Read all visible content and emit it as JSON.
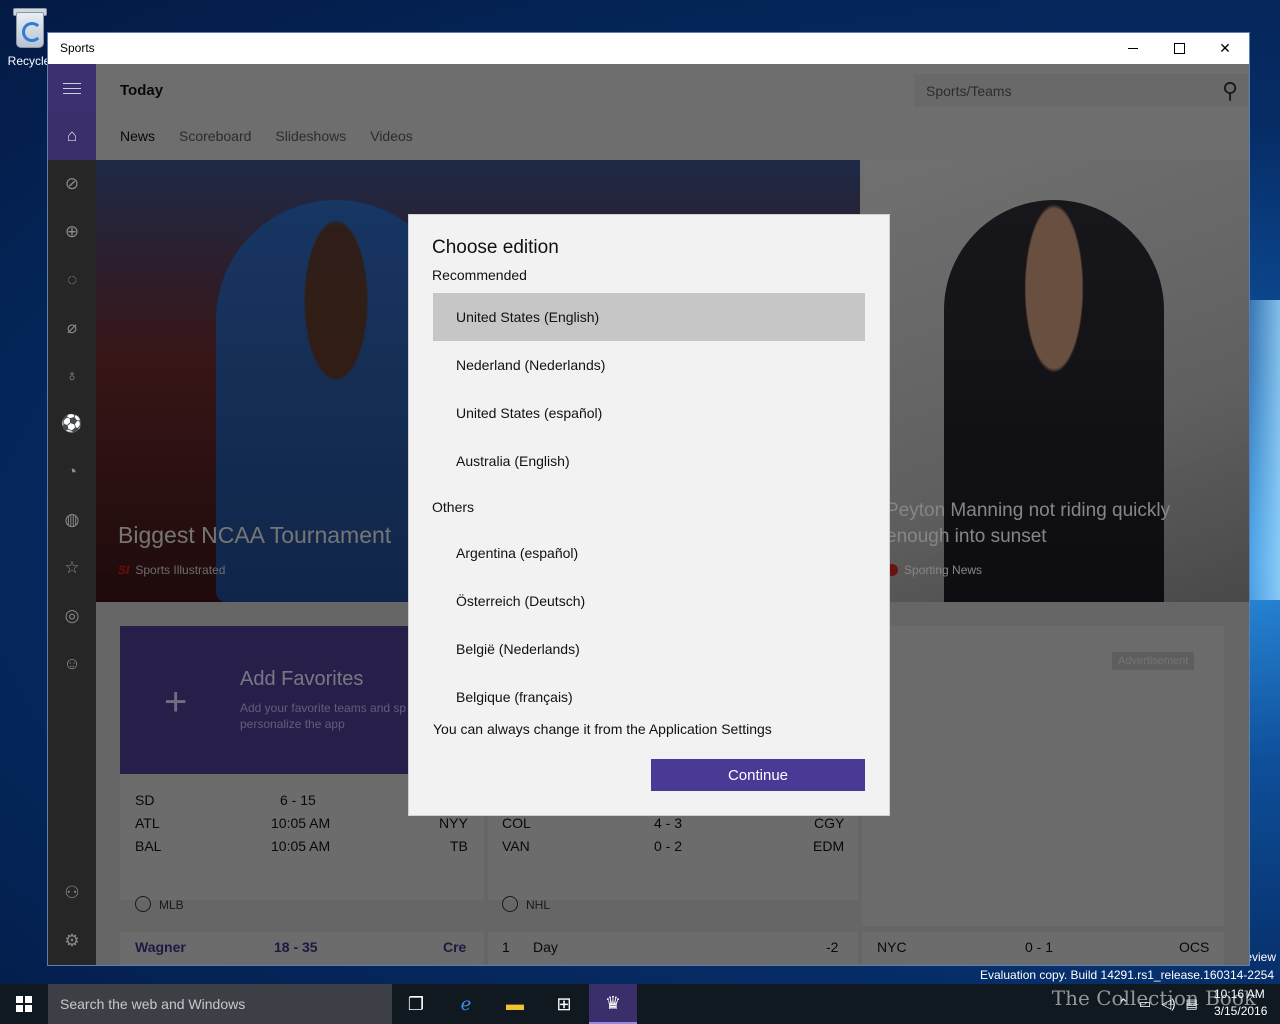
{
  "desktop": {
    "recycle_label": "Recycle",
    "eval_text": "Evaluation copy. Build 14291.rs1_release.160314-2254",
    "review_text": "eview",
    "watermark": "The Collection Book"
  },
  "window": {
    "title": "Sports",
    "page_title": "Today",
    "search_placeholder": "Sports/Teams",
    "tabs": [
      "News",
      "Scoreboard",
      "Slideshows",
      "Videos"
    ]
  },
  "hero": {
    "left_headline": "Biggest NCAA Tournament",
    "left_source": "Sports Illustrated",
    "left_source_logo": "SI",
    "right_headline": "Peyton Manning not riding quickly enough into sunset",
    "right_source": "Sporting News"
  },
  "favorites": {
    "title": "Add Favorites",
    "subtitle": "Add your favorite teams and sp personalize the app",
    "plus": "+"
  },
  "mlb": {
    "rows": [
      {
        "a": "SD",
        "score": "6  -  15",
        "b": ""
      },
      {
        "a": "ATL",
        "score": "10:05 AM",
        "b": "NYY"
      },
      {
        "a": "BAL",
        "score": "10:05 AM",
        "b": "TB"
      }
    ],
    "league": "MLB"
  },
  "nhl": {
    "rows": [
      {
        "a": "COL",
        "score": "4  -  3",
        "b": "CGY"
      },
      {
        "a": "VAN",
        "score": "0  -  2",
        "b": "EDM"
      }
    ],
    "league": "NHL"
  },
  "advert_label": "Advertisement",
  "bottom_strip": {
    "c1_a": "Wagner",
    "c1_score": "18  -  35",
    "c1_b": "Cre",
    "c2_rank": "1",
    "c2_name": "Day",
    "c2_val": "-2",
    "c3_a": "NYC",
    "c3_score": "0  -  1",
    "c3_b": "OCS"
  },
  "dialog": {
    "title": "Choose edition",
    "recommended_label": "Recommended",
    "recommended": [
      "United States (English)",
      "Nederland (Nederlands)",
      "United States (español)",
      "Australia (English)"
    ],
    "others_label": "Others",
    "others": [
      "Argentina (español)",
      "Österreich (Deutsch)",
      "België (Nederlands)",
      "Belgique (français)"
    ],
    "note": "You can always change it from the Application Settings",
    "continue_label": "Continue"
  },
  "taskbar": {
    "search_placeholder": "Search the web and Windows",
    "time": "10:16 AM",
    "date": "3/15/2016"
  },
  "colors": {
    "accent": "#4a3a95",
    "selected_option": "#c6c6c6"
  }
}
